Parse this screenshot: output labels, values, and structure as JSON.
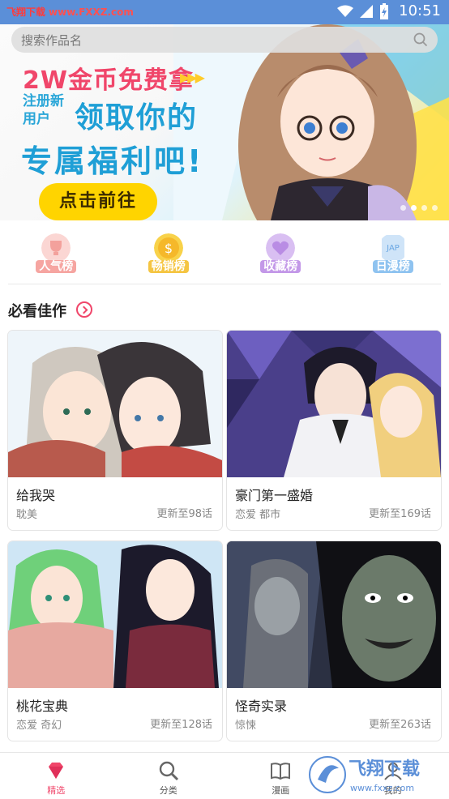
{
  "status_bar": {
    "site_label": "飞翔下载",
    "site_domain": "www.FXXZ.com",
    "time": "10:51"
  },
  "search": {
    "placeholder": "搜索作品名"
  },
  "banner": {
    "headline": "2W金币免费拿",
    "small_text": "注册新用户",
    "sub_line": "领取你的",
    "sub_line2": "专属福利吧!",
    "cta": "点击前往"
  },
  "rankings": [
    {
      "label": "人气榜",
      "color": "#f6a5a1"
    },
    {
      "label": "畅销榜",
      "color": "#f5c542"
    },
    {
      "label": "收藏榜",
      "color": "#c398e8"
    },
    {
      "label": "日漫榜",
      "color": "#8fc3f0"
    }
  ],
  "section": {
    "title": "必看佳作"
  },
  "comics": [
    {
      "title": "给我哭",
      "tags": "耽美",
      "update": "更新至98话"
    },
    {
      "title": "豪门第一盛婚",
      "tags": "恋爱 都市",
      "update": "更新至169话"
    },
    {
      "title": "桃花宝典",
      "tags": "恋爱 奇幻",
      "update": "更新至128话"
    },
    {
      "title": "怪奇实录",
      "tags": "惊悚",
      "update": "更新至263话"
    }
  ],
  "tabs": [
    {
      "label": "精选",
      "icon": "gem-icon",
      "active": true
    },
    {
      "label": "分类",
      "icon": "search-icon",
      "active": false
    },
    {
      "label": "漫画",
      "icon": "book-icon",
      "active": false
    },
    {
      "label": "我的",
      "icon": "user-icon",
      "active": false
    }
  ],
  "watermark": {
    "text": "飞翔下载",
    "domain": "www.fxxz.com"
  },
  "colors": {
    "accent": "#f0466a",
    "status_bar": "#5b8fd8",
    "cta": "#ffd400"
  }
}
